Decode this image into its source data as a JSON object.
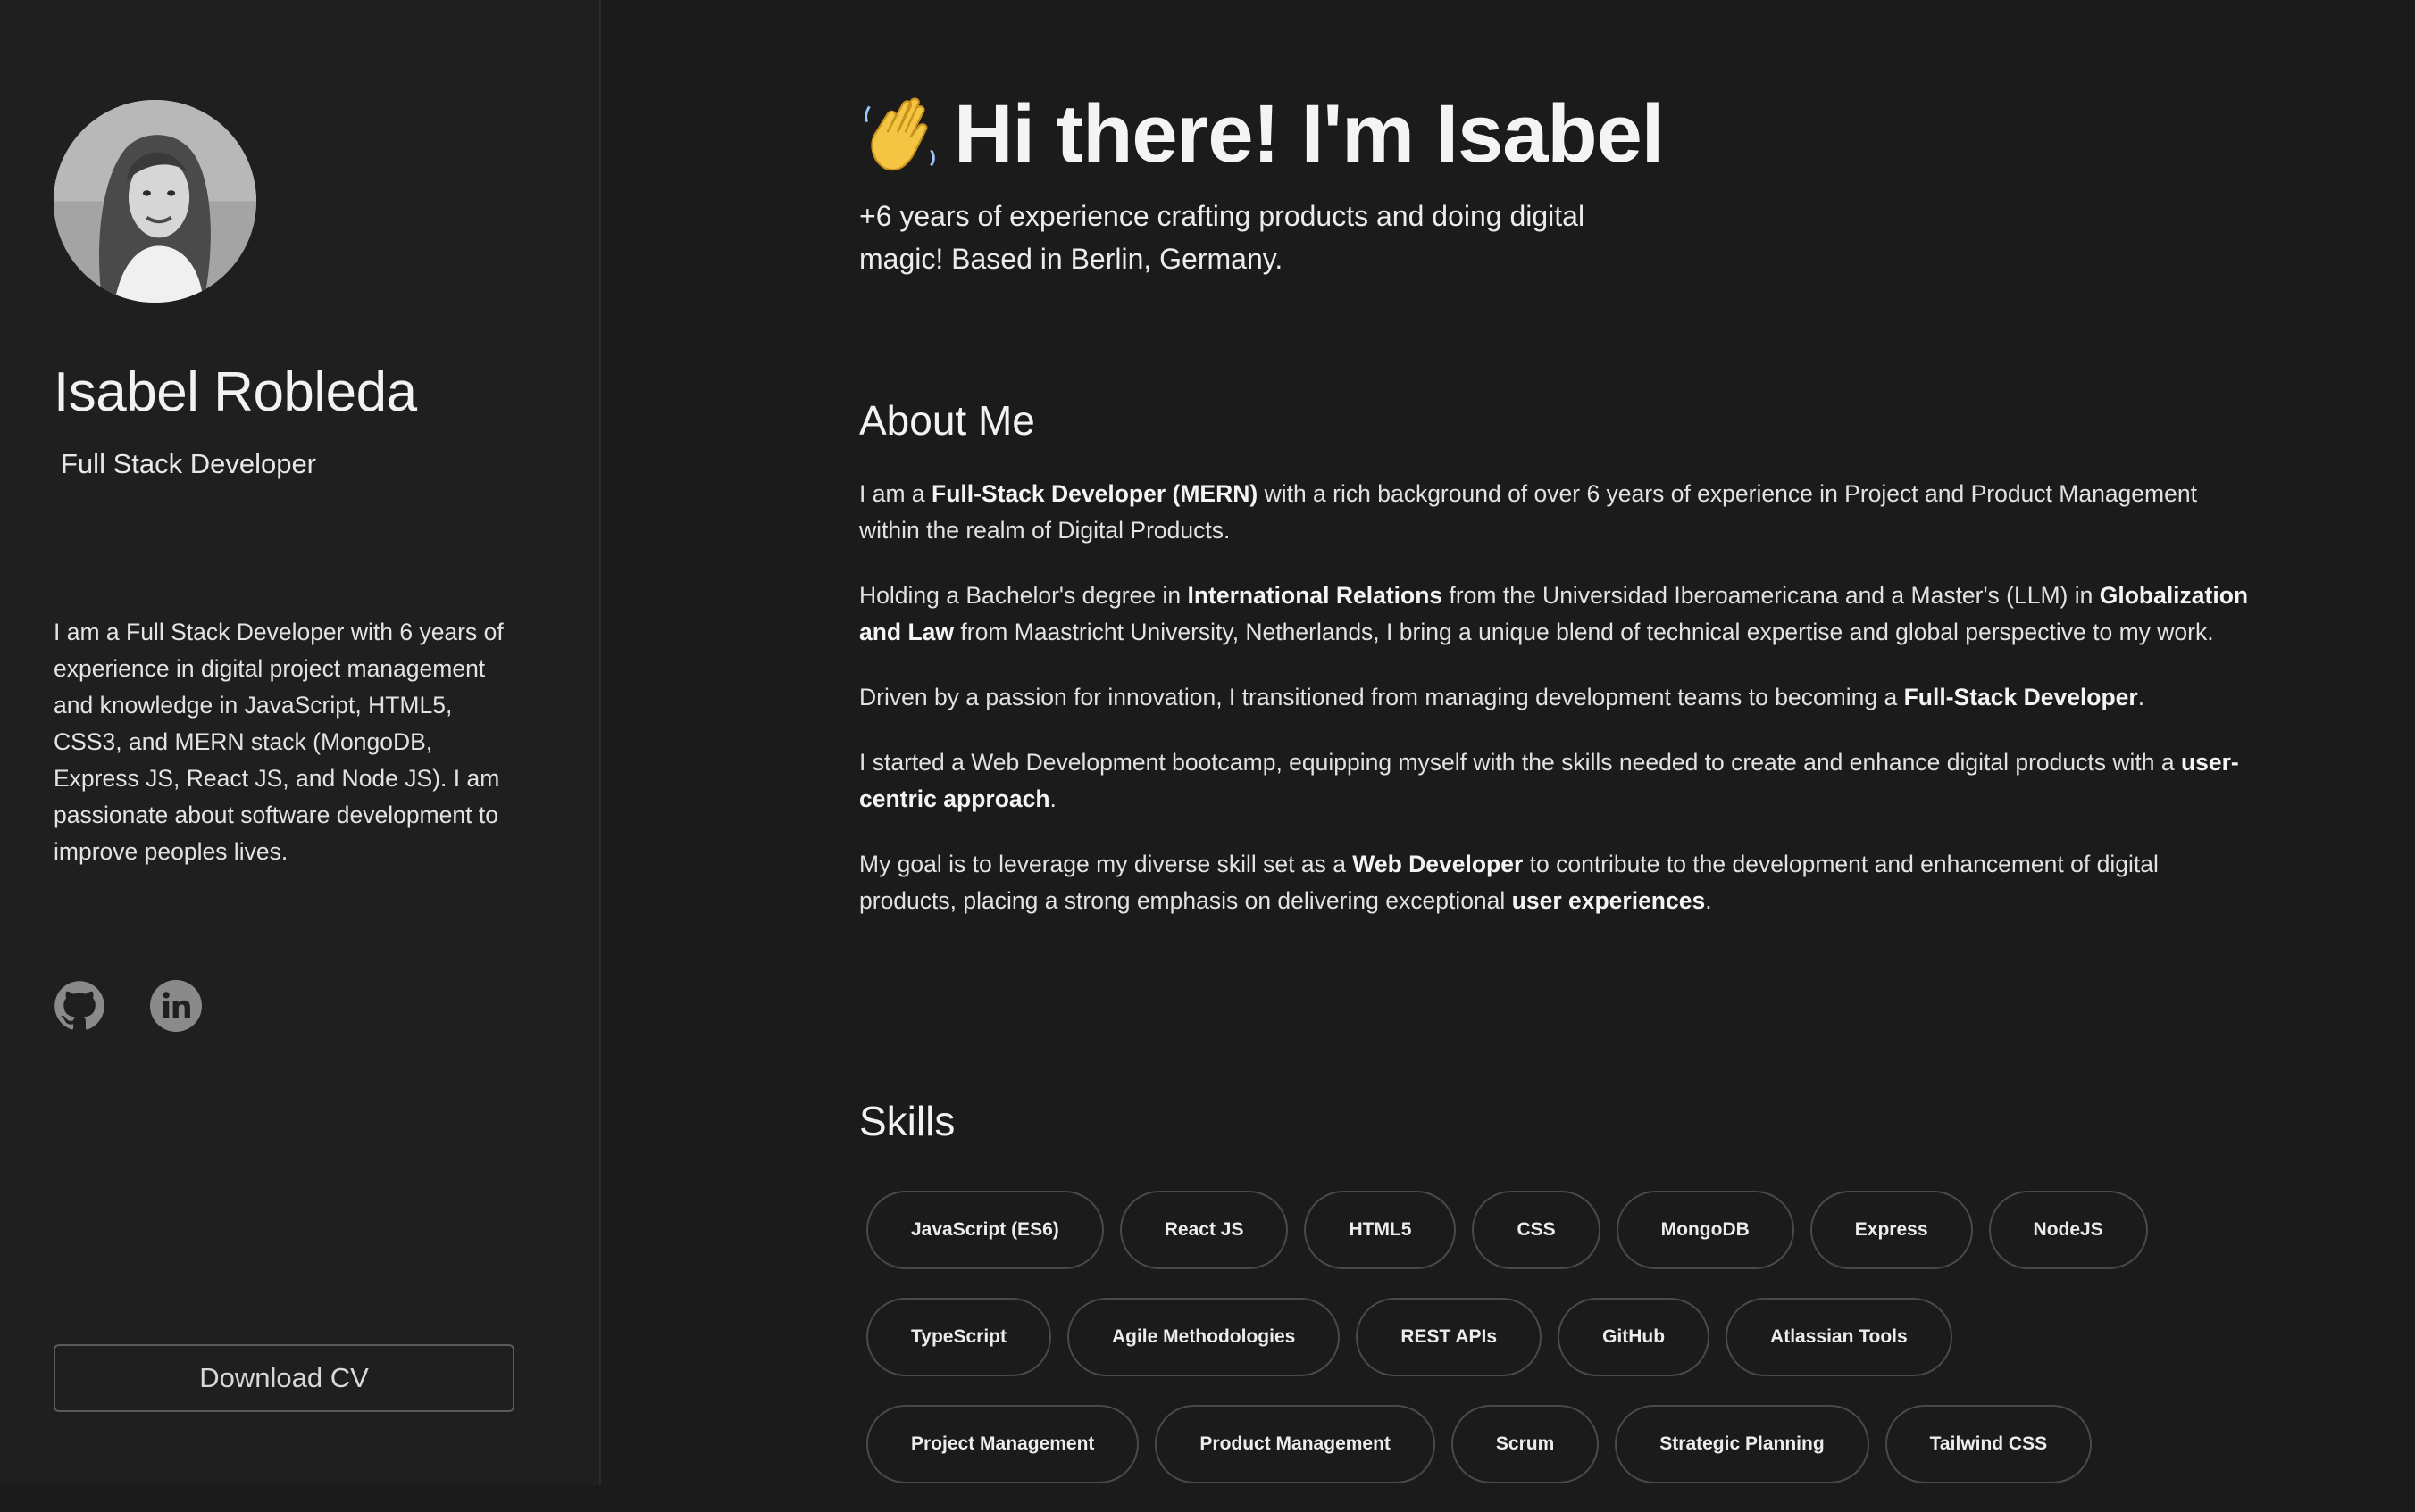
{
  "sidebar": {
    "name": "Isabel Robleda",
    "role": "Full Stack Developer",
    "bio": "I am a Full Stack Developer with 6 years of experience in digital project management and knowledge in JavaScript, HTML5, CSS3, and MERN stack (MongoDB, Express JS, React JS, and Node JS). I am passionate about software development to improve peoples lives.",
    "socials": [
      {
        "icon": "github-icon"
      },
      {
        "icon": "linkedin-icon"
      }
    ],
    "download_label": "Download CV"
  },
  "hero": {
    "emoji": "👋",
    "title": "Hi there! I'm Isabel",
    "subtitle": "+6 years of experience crafting products and doing digital magic! Based in Berlin, Germany."
  },
  "about": {
    "title": "About Me",
    "paragraphs": [
      [
        {
          "t": "I am a "
        },
        {
          "t": "Full-Stack Developer (MERN)",
          "b": true
        },
        {
          "t": " with a rich background of over 6 years of experience in Project and Product Management within the realm of Digital Products."
        }
      ],
      [
        {
          "t": "Holding a Bachelor's degree in "
        },
        {
          "t": "International Relations",
          "b": true
        },
        {
          "t": " from the Universidad Iberoamericana and a Master's (LLM) in "
        },
        {
          "t": "Globalization and Law",
          "b": true
        },
        {
          "t": " from Maastricht University, Netherlands, I bring a unique blend of technical expertise and global perspective to my work."
        }
      ],
      [
        {
          "t": "Driven by a passion for innovation, I transitioned from managing development teams to becoming a "
        },
        {
          "t": "Full-Stack Developer",
          "b": true
        },
        {
          "t": "."
        }
      ],
      [
        {
          "t": "I started a Web Development bootcamp, equipping myself with the skills needed to create and enhance digital products with a "
        },
        {
          "t": "user-centric approach",
          "b": true
        },
        {
          "t": "."
        }
      ],
      [
        {
          "t": "My goal is to leverage my diverse skill set as a "
        },
        {
          "t": "Web Developer",
          "b": true
        },
        {
          "t": " to contribute to the development and enhancement of digital products, placing a strong emphasis on delivering exceptional "
        },
        {
          "t": "user experiences",
          "b": true
        },
        {
          "t": "."
        }
      ]
    ]
  },
  "skills": {
    "title": "Skills",
    "rows": [
      [
        "JavaScript (ES6)",
        "React JS",
        "HTML5",
        "CSS",
        "MongoDB",
        "Express",
        "NodeJS"
      ],
      [
        "TypeScript",
        "Agile Methodologies",
        "REST APIs",
        "GitHub",
        "Atlassian Tools"
      ],
      [
        "Project Management",
        "Product Management",
        "Scrum",
        "Strategic Planning",
        "Tailwind CSS"
      ]
    ]
  }
}
